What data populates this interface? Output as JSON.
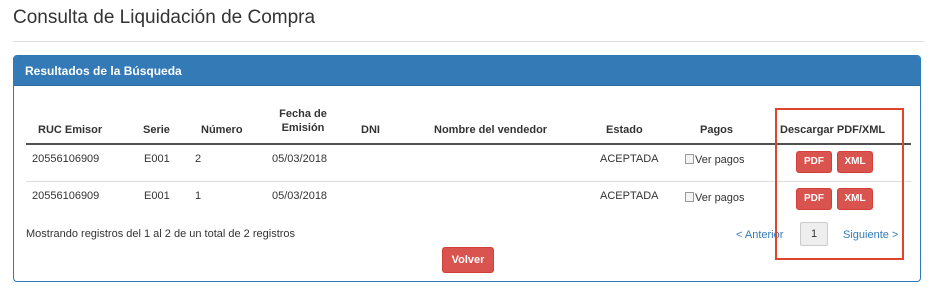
{
  "page": {
    "title": "Consulta de Liquidación de Compra"
  },
  "panel": {
    "heading": "Resultados de la Búsqueda"
  },
  "table": {
    "headers": {
      "ruc": "RUC Emisor",
      "serie": "Serie",
      "numero": "Número",
      "fecha_line1": "Fecha de",
      "fecha_line2": "Emisión",
      "dni": "DNI",
      "vendedor": "Nombre del vendedor",
      "estado": "Estado",
      "pagos": "Pagos",
      "descargar": "Descargar PDF/XML"
    },
    "rows": [
      {
        "ruc": "20556106909",
        "serie": "E001",
        "numero": "2",
        "fecha": "05/03/2018",
        "dni": "",
        "vendedor": "",
        "estado": "ACEPTADA",
        "pagos_alt": "Ver pagos",
        "pdf": "PDF",
        "xml": "XML"
      },
      {
        "ruc": "20556106909",
        "serie": "E001",
        "numero": "1",
        "fecha": "05/03/2018",
        "dni": "",
        "vendedor": "",
        "estado": "ACEPTADA",
        "pagos_alt": "Ver pagos",
        "pdf": "PDF",
        "xml": "XML"
      }
    ]
  },
  "footer": {
    "info": "Mostrando registros del 1 al 2 de un total de 2 registros",
    "prev": "< Anterior",
    "current_page": "1",
    "next": "Siguiente >",
    "back_button": "Volver"
  },
  "colors": {
    "primary": "#337ab7",
    "danger": "#d9534f",
    "highlight": "#e0452c"
  }
}
